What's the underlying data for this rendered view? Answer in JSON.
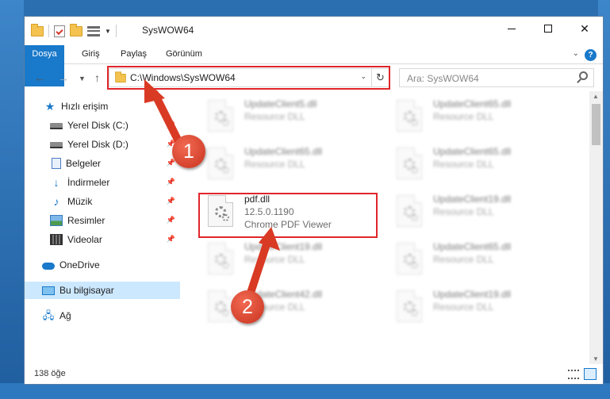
{
  "window": {
    "title": "SysWOW64",
    "controls": {
      "minimize": "–",
      "maximize": "□",
      "close": "✕"
    }
  },
  "ribbon": {
    "tabs": [
      {
        "label": "Dosya",
        "active": true
      },
      {
        "label": "Giriş"
      },
      {
        "label": "Paylaş"
      },
      {
        "label": "Görünüm"
      }
    ],
    "help": "?"
  },
  "address": {
    "path": "C:\\Windows\\SysWOW64",
    "search_placeholder": "Ara: SysWOW64"
  },
  "nav_pane": {
    "items": [
      {
        "label": "Hızlı erişim",
        "icon": "star-icon"
      },
      {
        "label": "Yerel Disk (C:)",
        "icon": "drive-icon",
        "pinned": true
      },
      {
        "label": "Yerel Disk (D:)",
        "icon": "drive-icon",
        "pinned": true
      },
      {
        "label": "Belgeler",
        "icon": "document-icon",
        "pinned": true
      },
      {
        "label": "İndirmeler",
        "icon": "download-icon",
        "pinned": true
      },
      {
        "label": "Müzik",
        "icon": "music-icon",
        "pinned": true
      },
      {
        "label": "Resimler",
        "icon": "picture-icon",
        "pinned": true
      },
      {
        "label": "Videolar",
        "icon": "video-icon",
        "pinned": true
      },
      {
        "label": "OneDrive",
        "icon": "cloud-icon"
      },
      {
        "label": "Bu bilgisayar",
        "icon": "computer-icon",
        "selected": true
      },
      {
        "label": "Ağ",
        "icon": "network-icon"
      }
    ]
  },
  "files": [
    {
      "name": "UpdateClient5.dll",
      "type": "Resource DLL"
    },
    {
      "name": "UpdateClient65.dll",
      "type": "Resource DLL"
    },
    {
      "name": "UpdateClient65.dll",
      "type": "Resource DLL"
    },
    {
      "name": "UpdateClient65.dll",
      "type": "Resource DLL"
    },
    {
      "name": "pdf.dll",
      "version": "12.5.0.1190",
      "type": "Chrome PDF Viewer"
    },
    {
      "name": "UpdateClient19.dll",
      "type": "Resource DLL"
    },
    {
      "name": "UpdateClient19.dll",
      "type": "Resource DLL"
    },
    {
      "name": "UpdateClient65.dll",
      "type": "Resource DLL"
    },
    {
      "name": "UpdateClient42.dll",
      "type": "Resource DLL"
    },
    {
      "name": "UpdateClient19.dll",
      "type": "Resource DLL"
    }
  ],
  "status": {
    "item_count": "138 öğe"
  },
  "annotations": {
    "badge1": "1",
    "badge2": "2",
    "highlight_color": "#e0262b"
  }
}
